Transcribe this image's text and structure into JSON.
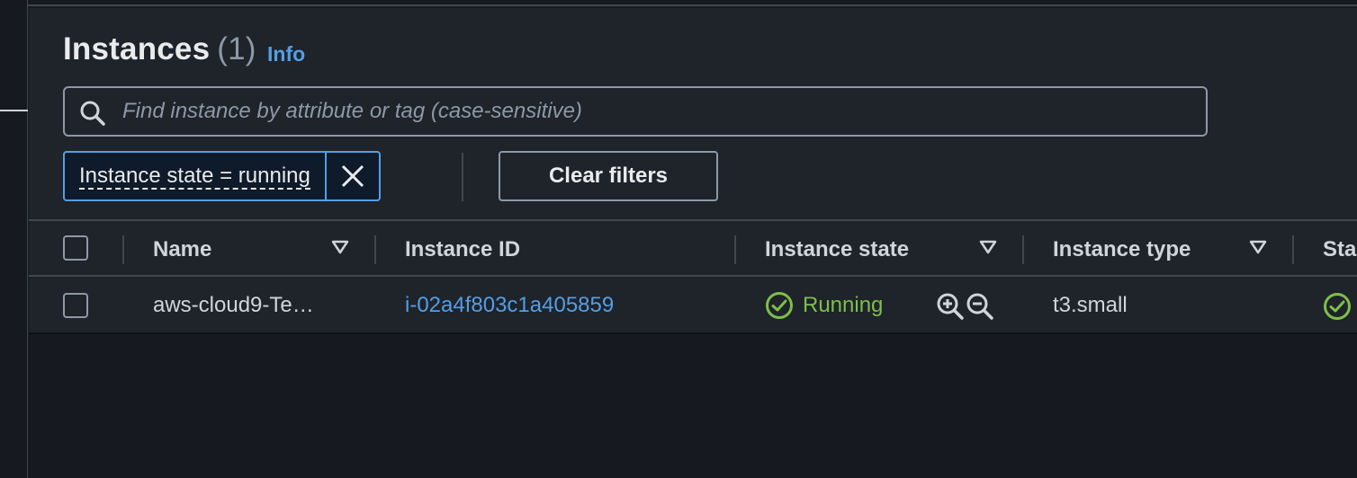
{
  "header": {
    "title": "Instances",
    "count": "(1)",
    "info": "Info"
  },
  "search": {
    "placeholder": "Find instance by attribute or tag (case-sensitive)"
  },
  "filters": {
    "token_label": "Instance state = running",
    "clear_label": "Clear filters"
  },
  "table": {
    "columns": [
      "Name",
      "Instance ID",
      "Instance state",
      "Instance type",
      "Sta"
    ],
    "rows": [
      {
        "name": "aws-cloud9-Te…",
        "instance_id": "i-02a4f803c1a405859",
        "state": "Running",
        "type": "t3.small"
      }
    ]
  },
  "colors": {
    "accent": "#539fe5",
    "running": "#7dbf4a",
    "background": "#16191f",
    "panel": "#1f232a"
  },
  "icons": [
    "search-icon",
    "close-icon",
    "sort-caret-icon",
    "check-circle-icon",
    "zoom-in-icon",
    "zoom-out-icon"
  ]
}
